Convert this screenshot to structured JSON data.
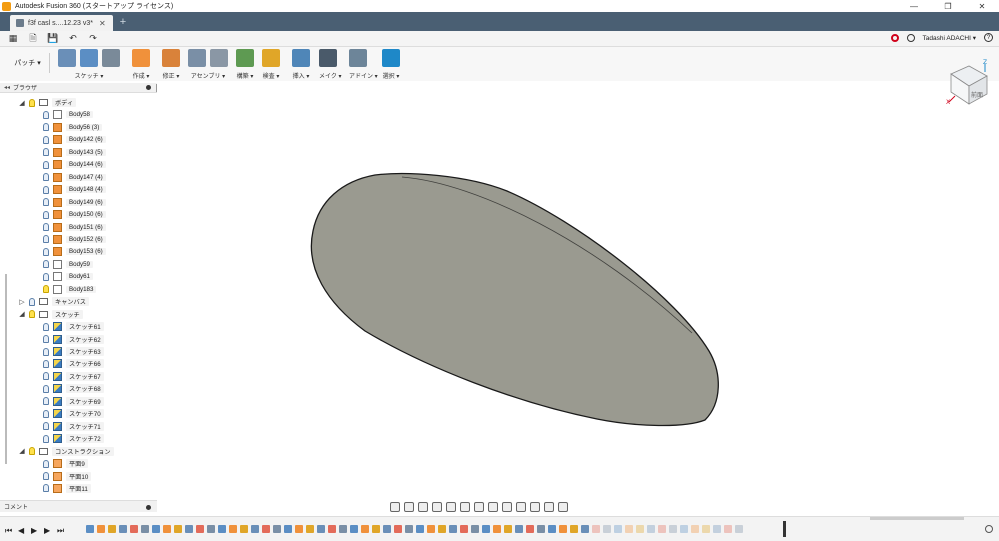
{
  "window": {
    "title": "Autodesk Fusion 360 (スタートアップ ライセンス)",
    "controls": [
      "—",
      "❐",
      "✕"
    ]
  },
  "tabs": [
    {
      "label": "f3f casl s....12.23  v3*",
      "close": "✕"
    }
  ],
  "tab_add": "+",
  "quickbar": {
    "user": "Tadashi ADACHI ▾",
    "help": "?"
  },
  "workspace": {
    "label": "パッチ ▾"
  },
  "toolbar_groups": [
    {
      "label": "スケッチ ▾",
      "icon_count": 3,
      "colors": [
        "#6a8fb8",
        "#5b8ec4",
        "#7a8a99"
      ]
    },
    {
      "label": "作成 ▾",
      "icon_count": 1,
      "colors": [
        "#f0913b"
      ]
    },
    {
      "label": "修正 ▾",
      "icon_count": 1,
      "colors": [
        "#d9823a"
      ]
    },
    {
      "label": "アセンブリ ▾",
      "icon_count": 2,
      "colors": [
        "#7a8fa6",
        "#8a97a5"
      ]
    },
    {
      "label": "構築 ▾",
      "icon_count": 1,
      "colors": [
        "#5e9a52"
      ]
    },
    {
      "label": "検査 ▾",
      "icon_count": 1,
      "colors": [
        "#e0a628"
      ]
    },
    {
      "label": "挿入 ▾",
      "icon_count": 1,
      "colors": [
        "#4f86b8"
      ]
    },
    {
      "label": "メイク ▾",
      "icon_count": 1,
      "colors": [
        "#4a5a6a"
      ]
    },
    {
      "label": "アドイン ▾",
      "icon_count": 1,
      "colors": [
        "#6d8599"
      ]
    },
    {
      "label": "選択 ▾",
      "icon_count": 1,
      "colors": [
        "#1e88c8"
      ]
    }
  ],
  "browser": {
    "header": "ブラウザ",
    "comment": "コメント",
    "rows": [
      {
        "label": "ボディ",
        "type": "folder",
        "indent": 0,
        "toggle": "◢",
        "bulb_on": true
      },
      {
        "label": "Body58",
        "type": "body-plain",
        "indent": 1,
        "bulb_on": false
      },
      {
        "label": "Body56 (3)",
        "type": "body",
        "indent": 1,
        "bulb_on": false
      },
      {
        "label": "Body142 (6)",
        "type": "body",
        "indent": 1,
        "bulb_on": false
      },
      {
        "label": "Body143 (5)",
        "type": "body",
        "indent": 1,
        "bulb_on": false
      },
      {
        "label": "Body144 (6)",
        "type": "body",
        "indent": 1,
        "bulb_on": false
      },
      {
        "label": "Body147 (4)",
        "type": "body",
        "indent": 1,
        "bulb_on": false
      },
      {
        "label": "Body148 (4)",
        "type": "body",
        "indent": 1,
        "bulb_on": false
      },
      {
        "label": "Body149 (6)",
        "type": "body",
        "indent": 1,
        "bulb_on": false
      },
      {
        "label": "Body150 (6)",
        "type": "body",
        "indent": 1,
        "bulb_on": false
      },
      {
        "label": "Body151 (6)",
        "type": "body",
        "indent": 1,
        "bulb_on": false
      },
      {
        "label": "Body152 (6)",
        "type": "body",
        "indent": 1,
        "bulb_on": false
      },
      {
        "label": "Body153 (6)",
        "type": "body",
        "indent": 1,
        "bulb_on": false
      },
      {
        "label": "Body59",
        "type": "body-plain",
        "indent": 1,
        "bulb_on": false
      },
      {
        "label": "Body61",
        "type": "body-plain",
        "indent": 1,
        "bulb_on": false
      },
      {
        "label": "Body183",
        "type": "body-plain",
        "indent": 1,
        "bulb_on": true
      },
      {
        "label": "キャンバス",
        "type": "folder",
        "indent": 0,
        "toggle": "▷",
        "bulb_on": false
      },
      {
        "label": "スケッチ",
        "type": "folder",
        "indent": 0,
        "toggle": "◢",
        "bulb_on": true
      },
      {
        "label": "スケッチ61",
        "type": "sketch",
        "indent": 1,
        "bulb_on": false
      },
      {
        "label": "スケッチ62",
        "type": "sketch",
        "indent": 1,
        "bulb_on": false
      },
      {
        "label": "スケッチ63",
        "type": "sketch",
        "indent": 1,
        "bulb_on": false
      },
      {
        "label": "スケッチ66",
        "type": "sketch",
        "indent": 1,
        "bulb_on": false
      },
      {
        "label": "スケッチ67",
        "type": "sketch",
        "indent": 1,
        "bulb_on": false
      },
      {
        "label": "スケッチ68",
        "type": "sketch",
        "indent": 1,
        "bulb_on": false
      },
      {
        "label": "スケッチ69",
        "type": "sketch",
        "indent": 1,
        "bulb_on": false
      },
      {
        "label": "スケッチ70",
        "type": "sketch",
        "indent": 1,
        "bulb_on": false
      },
      {
        "label": "スケッチ71",
        "type": "sketch",
        "indent": 1,
        "bulb_on": false
      },
      {
        "label": "スケッチ72",
        "type": "sketch",
        "indent": 1,
        "bulb_on": false
      },
      {
        "label": "コンストラクション",
        "type": "folder",
        "indent": 0,
        "toggle": "◢",
        "bulb_on": true
      },
      {
        "label": "平面9",
        "type": "plane",
        "indent": 1,
        "bulb_on": false
      },
      {
        "label": "平面10",
        "type": "plane",
        "indent": 1,
        "bulb_on": false
      },
      {
        "label": "平面11",
        "type": "plane",
        "indent": 1,
        "bulb_on": false
      }
    ]
  },
  "viewcube": {
    "face_label": "前面",
    "axis_x": "X",
    "axis_z": "Z"
  },
  "model_colors": {
    "surface": "#9a9a90",
    "edge": "#1a1a1a"
  },
  "timeline": {
    "controls": [
      "⏮",
      "◀",
      "▶",
      "▶",
      "⏭"
    ],
    "item_colors": [
      "#5b8ec4",
      "#f0913b",
      "#e0a628",
      "#6a8fb8",
      "#e36b5a",
      "#7a8fa6"
    ]
  }
}
